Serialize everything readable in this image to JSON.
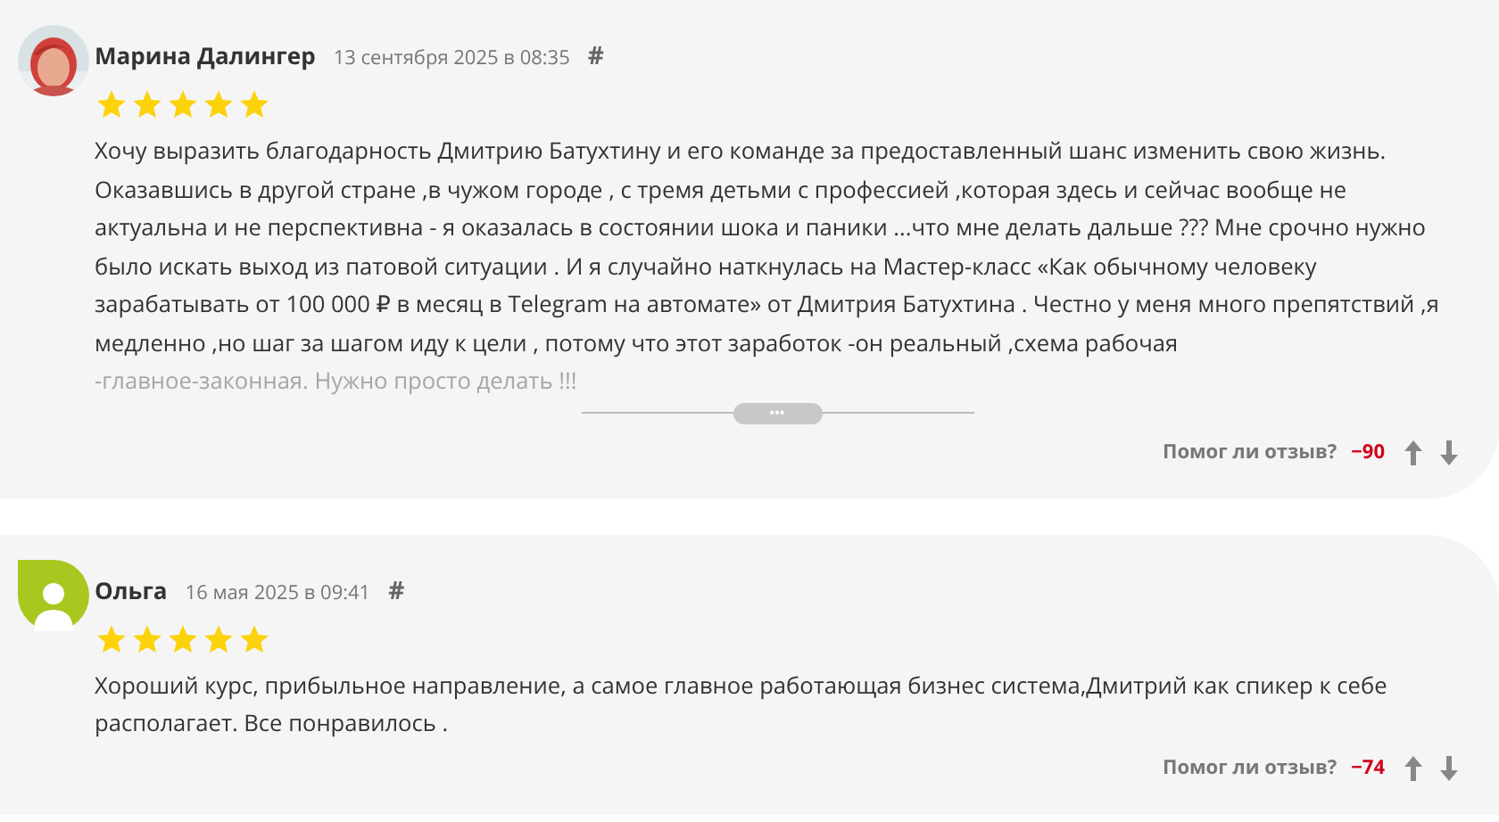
{
  "reviews": [
    {
      "author": "Марина Далингер",
      "date": "13 сентября 2025 в 08:35",
      "anchor": "#",
      "stars": 5,
      "text": "Хочу выразить благодарность Дмитрию Батухтину и его команде за предоставленный шанс изменить свою жизнь. Оказавшись в другой стране ,в чужом городе , с тремя детьми с профессией ,которая здесь и сейчас вообще не актуальна и не перспективна - я оказалась в состоянии шока и паники ...что мне делать дальше ??? Мне срочно нужно было искать выход из патовой ситуации . И я случайно наткнулась на Мастер-класс «Как обычному человеку зарабатывать от 100 000 ₽ в месяц в Telegram на автомате» от Дмитрия Батухтина . Честно у меня много препятствий ,я медленно ,но шаг за шагом иду к цели , потому что этот заработок -он реальный ,схема рабочая",
      "faded_text": "-главное-законная. Нужно просто делать !!!",
      "expand": "•••",
      "helpful_label": "Помог ли отзыв?",
      "score": "−90"
    },
    {
      "avatar": {
        "kind": "placeholder"
      },
      "author": "Ольга",
      "date": "16 мая 2025 в 09:41",
      "anchor": "#",
      "stars": 5,
      "text": "Хороший курс, прибыльное направление, а самое главное работающая бизнес система,Дмитрий как спикер к себе располагает. Все понравилось .",
      "helpful_label": "Помог ли отзыв?",
      "score": "−74"
    }
  ]
}
